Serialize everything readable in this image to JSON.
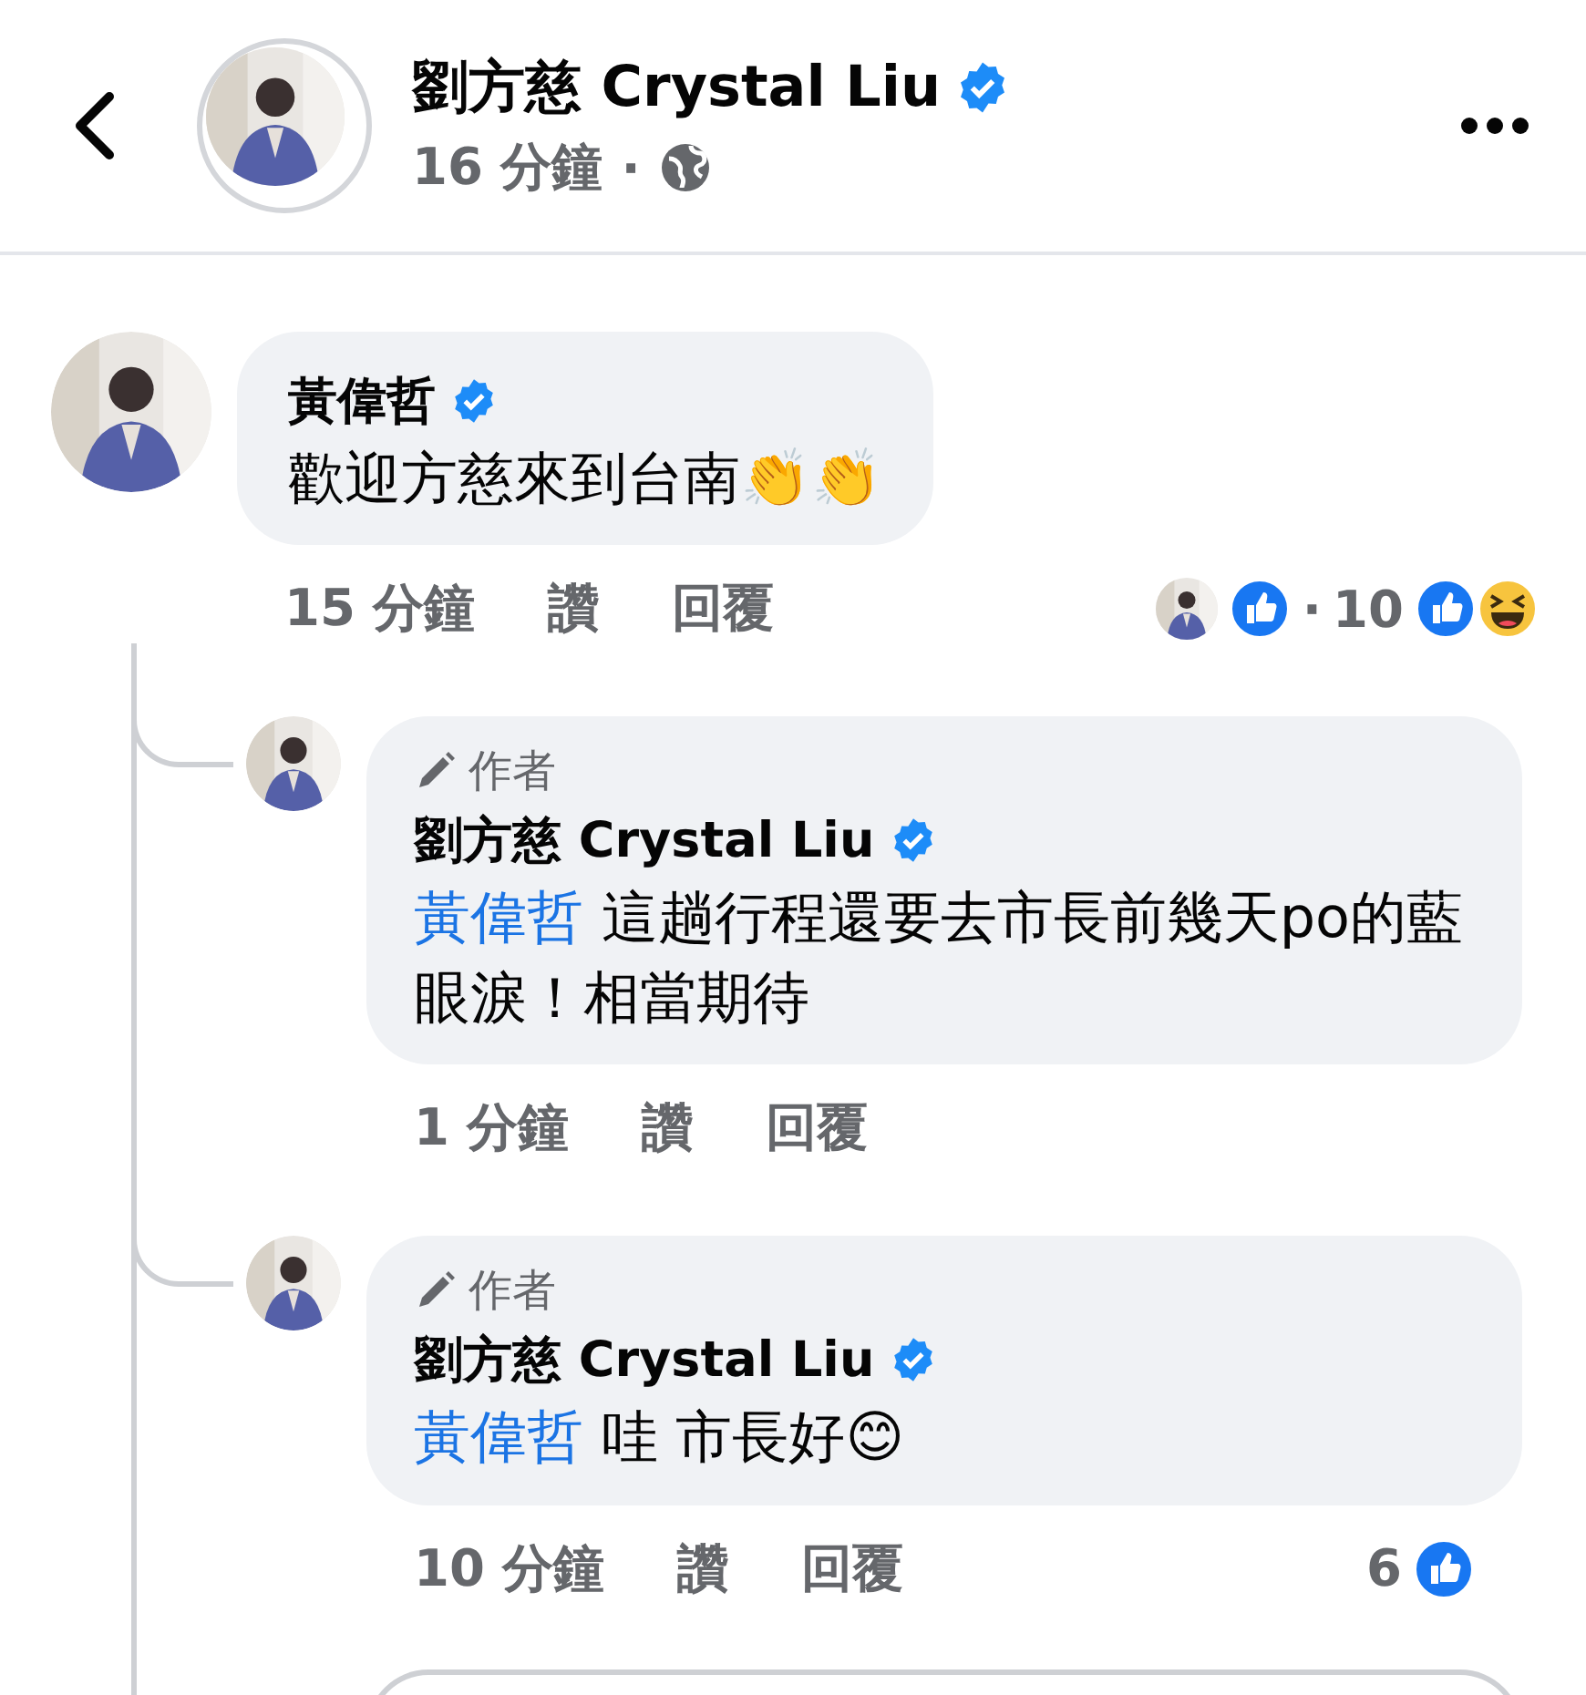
{
  "header": {
    "author": "劉方慈 Crystal Liu",
    "verified": true,
    "time": "16 分鐘",
    "separator": "·"
  },
  "comments": [
    {
      "author": "黃偉哲",
      "verified": true,
      "text": "歡迎方慈來到台南👏👏",
      "time": "15 分鐘",
      "like": "讚",
      "reply": "回覆",
      "author_liked": true,
      "separator": "·",
      "reaction_count": "10",
      "reactions": [
        {
          "kind": "like"
        },
        {
          "kind": "haha"
        }
      ],
      "replies": [
        {
          "badge": "作者",
          "author": "劉方慈 Crystal Liu",
          "verified": true,
          "mention": "黃偉哲",
          "text": "這趟行程還要去市長前幾天po的藍眼淚！相當期待",
          "time": "1 分鐘",
          "like": "讚",
          "reply": "回覆"
        },
        {
          "badge": "作者",
          "author": "劉方慈 Crystal Liu",
          "verified": true,
          "mention": "黃偉哲",
          "text": "哇 市長好😊",
          "time": "10 分鐘",
          "like": "讚",
          "reply": "回覆",
          "reaction_count": "6",
          "reactions": [
            {
              "kind": "like"
            }
          ]
        }
      ]
    }
  ]
}
